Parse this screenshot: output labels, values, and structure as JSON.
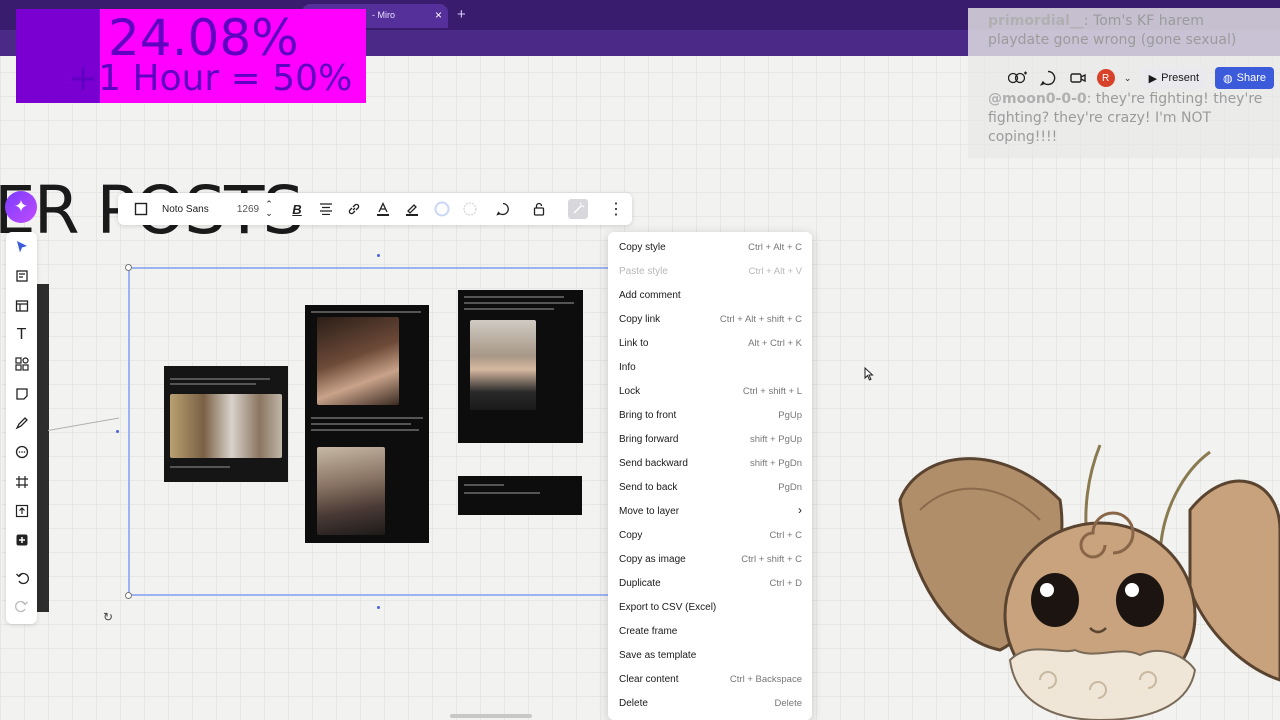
{
  "browser": {
    "tab_title": "- Miro",
    "tab_close": "×",
    "new_tab": "+"
  },
  "stream_overlay": {
    "percent": "24.08%",
    "hour_text": "+1 Hour = 50%"
  },
  "chat": {
    "messages": [
      {
        "user": "primordial__",
        "text": ": Tom's KF harem playdate gone wrong (gone sexual)"
      },
      {
        "user": "@moon0-0-0",
        "text": ": they're fighting! they're fighting? they're crazy! I'm NOT coping!!!!"
      }
    ]
  },
  "top_toolbar": {
    "present_label": "Present",
    "share_label": "Share",
    "avatar_initial": "R"
  },
  "canvas": {
    "heading_text": "ER POSTS"
  },
  "format_toolbar": {
    "font_name": "Noto Sans",
    "font_size": "1269"
  },
  "context_menu": {
    "items": [
      {
        "label": "Copy style",
        "shortcut": "Ctrl + Alt + C"
      },
      {
        "label": "Paste style",
        "shortcut": "Ctrl + Alt + V",
        "disabled": true
      },
      {
        "label": "Add comment",
        "shortcut": ""
      },
      {
        "label": "Copy link",
        "shortcut": "Ctrl + Alt + shift + C"
      },
      {
        "label": "Link to",
        "shortcut": "Alt + Ctrl + K"
      },
      {
        "label": "Info",
        "shortcut": ""
      },
      {
        "label": "Lock",
        "shortcut": "Ctrl + shift + L"
      },
      {
        "label": "Bring to front",
        "shortcut": "PgUp"
      },
      {
        "label": "Bring forward",
        "shortcut": "shift + PgUp"
      },
      {
        "label": "Send backward",
        "shortcut": "shift + PgDn"
      },
      {
        "label": "Send to back",
        "shortcut": "PgDn"
      },
      {
        "label": "Move to layer",
        "shortcut": "›"
      },
      {
        "label": "Copy",
        "shortcut": "Ctrl + C"
      },
      {
        "label": "Copy as image",
        "shortcut": "Ctrl + shift + C"
      },
      {
        "label": "Duplicate",
        "shortcut": "Ctrl + D"
      },
      {
        "label": "Export to CSV (Excel)",
        "shortcut": ""
      },
      {
        "label": "Create frame",
        "shortcut": ""
      },
      {
        "label": "Save as template",
        "shortcut": ""
      },
      {
        "label": "Clear content",
        "shortcut": "Ctrl + Backspace"
      },
      {
        "label": "Delete",
        "shortcut": "Delete"
      }
    ]
  },
  "colors": {
    "accent": "#3b5bdb",
    "overlay_magenta": "#ff00ff",
    "overlay_purple": "#7a00d2",
    "browser_purple": "#3a1c6e"
  }
}
